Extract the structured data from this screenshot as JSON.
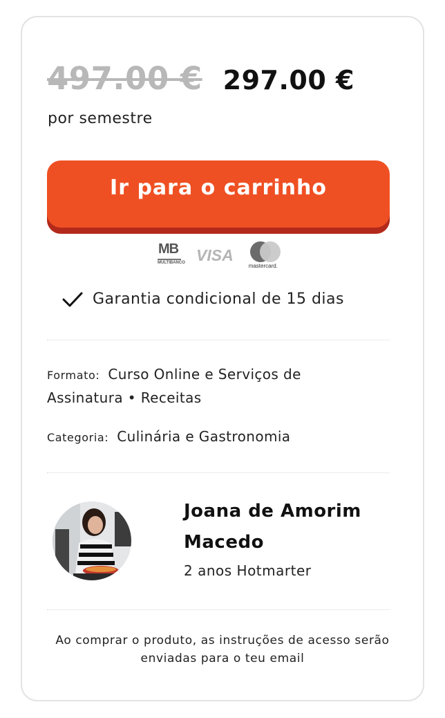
{
  "pricing": {
    "old_price": "497.00 €",
    "new_price": "297.00 €",
    "period": "por semestre"
  },
  "cart_button": {
    "label": "Ir para o carrinho"
  },
  "payments": {
    "mb_label": "MB",
    "mb_sub": "MULTIBANCO",
    "visa_label": "VISA",
    "mastercard_label": "mastercard."
  },
  "guarantee": {
    "text": "Garantia condicional de 15 dias"
  },
  "details": {
    "format_label": "Formato:",
    "format_value": "Curso Online e Serviços de Assinatura • Receitas",
    "category_label": "Categoria:",
    "category_value": "Culinária e Gastronomia"
  },
  "author": {
    "name": "Joana de Amorim Macedo",
    "subtitle": "2 anos Hotmarter"
  },
  "footnote": {
    "text": "Ao comprar o produto, as instruções de acesso serão enviadas para o teu email"
  },
  "colors": {
    "accent": "#ef5023",
    "accent_shadow": "#b32a1c",
    "old_price": "#b8b8b8"
  }
}
